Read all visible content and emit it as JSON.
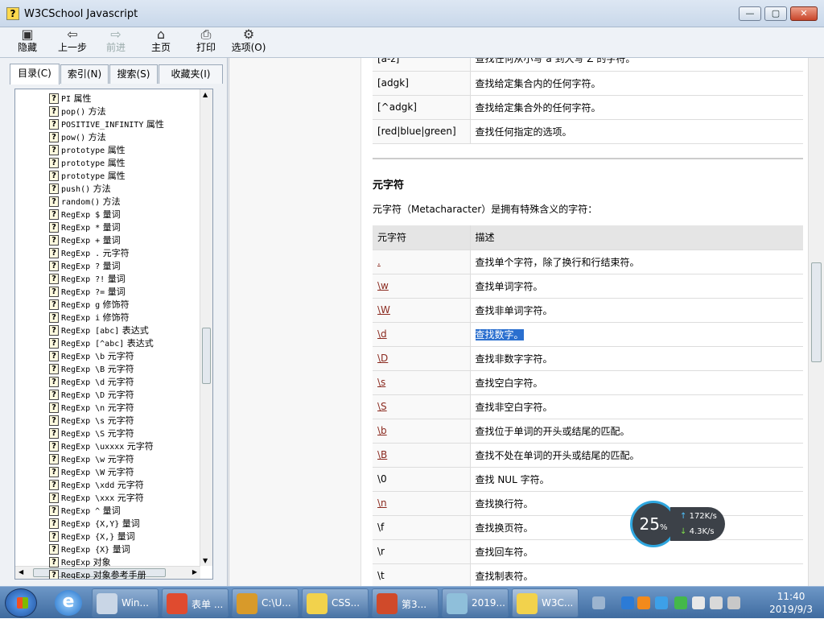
{
  "window": {
    "title": "W3CSchool Javascript"
  },
  "toolbar": {
    "hide": "隐藏",
    "back": "上一步",
    "forward": "前进",
    "home": "主页",
    "print": "打印",
    "options": "选项(O)"
  },
  "tabs": [
    "目录(C)",
    "索引(N)",
    "搜索(S)",
    "收藏夹(I)"
  ],
  "tree": [
    {
      "code": "PI",
      "text": "属性"
    },
    {
      "code": "pop()",
      "text": "方法"
    },
    {
      "code": "POSITIVE_INFINITY",
      "text": "属性"
    },
    {
      "code": "pow()",
      "text": "方法"
    },
    {
      "code": "prototype",
      "text": "属性"
    },
    {
      "code": "prototype",
      "text": "属性"
    },
    {
      "code": "prototype",
      "text": "属性"
    },
    {
      "code": "push()",
      "text": "方法"
    },
    {
      "code": "random()",
      "text": "方法"
    },
    {
      "code": "RegExp $",
      "text": "量词"
    },
    {
      "code": "RegExp *",
      "text": "量词"
    },
    {
      "code": "RegExp +",
      "text": "量词"
    },
    {
      "code": "RegExp .",
      "text": "元字符"
    },
    {
      "code": "RegExp ?",
      "text": "量词"
    },
    {
      "code": "RegExp ?!",
      "text": "量词"
    },
    {
      "code": "RegExp ?=",
      "text": "量词"
    },
    {
      "code": "RegExp g",
      "text": "修饰符"
    },
    {
      "code": "RegExp i",
      "text": "修饰符"
    },
    {
      "code": "RegExp [abc]",
      "text": "表达式"
    },
    {
      "code": "RegExp [^abc]",
      "text": "表达式"
    },
    {
      "code": "RegExp \\b",
      "text": "元字符"
    },
    {
      "code": "RegExp \\B",
      "text": "元字符"
    },
    {
      "code": "RegExp \\d",
      "text": "元字符"
    },
    {
      "code": "RegExp \\D",
      "text": "元字符"
    },
    {
      "code": "RegExp \\n",
      "text": "元字符"
    },
    {
      "code": "RegExp \\s",
      "text": "元字符"
    },
    {
      "code": "RegExp \\S",
      "text": "元字符"
    },
    {
      "code": "RegExp \\uxxxx",
      "text": "元字符"
    },
    {
      "code": "RegExp \\w",
      "text": "元字符"
    },
    {
      "code": "RegExp \\W",
      "text": "元字符"
    },
    {
      "code": "RegExp \\xdd",
      "text": "元字符"
    },
    {
      "code": "RegExp \\xxx",
      "text": "元字符"
    },
    {
      "code": "RegExp ^",
      "text": "量词"
    },
    {
      "code": "RegExp {X,Y}",
      "text": "量词"
    },
    {
      "code": "RegExp {X,}",
      "text": "量词"
    },
    {
      "code": "RegExp {X}",
      "text": "量词"
    },
    {
      "code": "RegExp",
      "text": "对象"
    },
    {
      "code": "RegExp",
      "text": "对象参考手册"
    }
  ],
  "top_table": [
    {
      "expr": "[a-z]",
      "desc": "查找任何从小写 a 到大写 Z 的字符。"
    },
    {
      "expr": "[adgk]",
      "desc": "查找给定集合内的任何字符。"
    },
    {
      "expr": "[^adgk]",
      "desc": "查找给定集合外的任何字符。"
    },
    {
      "expr": "[red|blue|green]",
      "desc": "查找任何指定的选项。"
    }
  ],
  "section": {
    "heading": "元字符",
    "intro": "元字符（Metacharacter）是拥有特殊含义的字符："
  },
  "meta_table": {
    "headers": [
      "元字符",
      "描述"
    ],
    "rows": [
      {
        "ch": ".",
        "desc": "查找单个字符，除了换行和行结束符。",
        "link": true
      },
      {
        "ch": "\\w",
        "desc": "查找单词字符。",
        "link": true
      },
      {
        "ch": "\\W",
        "desc": "查找非单词字符。",
        "link": true
      },
      {
        "ch": "\\d",
        "desc": "查找数字。",
        "link": true
      },
      {
        "ch": "\\D",
        "desc": "查找非数字字符。",
        "link": true
      },
      {
        "ch": "\\s",
        "desc": "查找空白字符。",
        "link": true
      },
      {
        "ch": "\\S",
        "desc": "查找非空白字符。",
        "link": true
      },
      {
        "ch": "\\b",
        "desc": "查找位于单词的开头或结尾的匹配。",
        "link": true
      },
      {
        "ch": "\\B",
        "desc": "查找不处在单词的开头或结尾的匹配。",
        "link": true
      },
      {
        "ch": "\\0",
        "desc": "查找 NUL 字符。",
        "link": false
      },
      {
        "ch": "\\n",
        "desc": "查找换行符。",
        "link": true
      },
      {
        "ch": "\\f",
        "desc": "查找换页符。",
        "link": false
      },
      {
        "ch": "\\r",
        "desc": "查找回车符。",
        "link": false
      },
      {
        "ch": "\\t",
        "desc": "查找制表符。",
        "link": false
      }
    ]
  },
  "speed": {
    "percent": "25",
    "pct_sign": "%",
    "up": "172",
    "down": "4.3",
    "unit": "K/s"
  },
  "taskbar": {
    "items": [
      "Win...",
      "表单 ...",
      "C:\\U...",
      "CSS...",
      "第3...",
      "2019...",
      "W3C..."
    ],
    "time": "11:40",
    "date": "2019/9/3"
  }
}
